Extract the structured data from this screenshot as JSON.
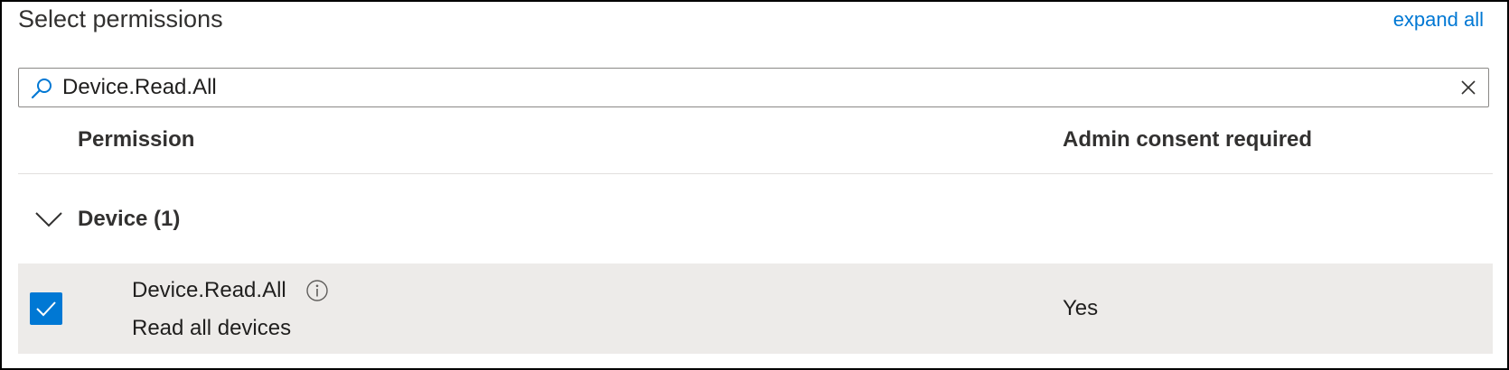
{
  "panel": {
    "title": "Select permissions",
    "expand_all_label": "expand all"
  },
  "search": {
    "value": "Device.Read.All",
    "icon": "search-icon",
    "clear_icon": "close-icon"
  },
  "table": {
    "columns": [
      "Permission",
      "Admin consent required"
    ],
    "groups": [
      {
        "label": "Device (1)",
        "expanded": true,
        "permissions": [
          {
            "name": "Device.Read.All",
            "description": "Read all devices",
            "admin_consent_required": "Yes",
            "checked": true
          }
        ]
      }
    ]
  },
  "colors": {
    "accent": "#0078d4",
    "selected_row_background": "#edebe9"
  }
}
